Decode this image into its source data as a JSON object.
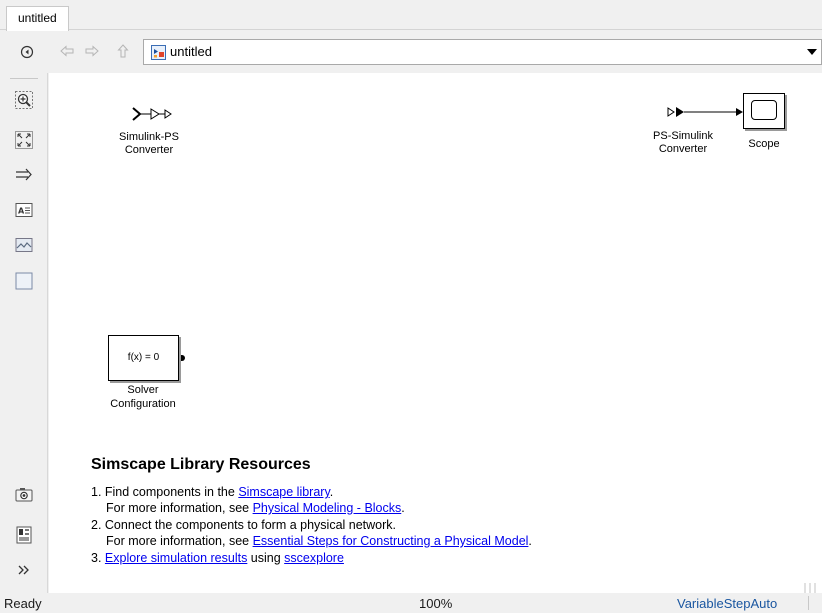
{
  "tab": {
    "label": "untitled"
  },
  "explorer": {
    "path": "untitled"
  },
  "blocks": {
    "simulink_ps": {
      "line1": "Simulink-PS",
      "line2": "Converter"
    },
    "ps_simulink": {
      "line1": "PS-Simulink",
      "line2": "Converter"
    },
    "scope": {
      "label": "Scope"
    },
    "solver": {
      "expr": "f(x) = 0",
      "line1": "Solver",
      "line2": "Configuration"
    }
  },
  "resources": {
    "title": "Simscape Library Resources",
    "line1": {
      "prefix": "1. Find components in the ",
      "link": "Simscape library",
      "suffix": "."
    },
    "line2": {
      "prefix": "For more information, see ",
      "link": "Physical Modeling - Blocks",
      "suffix": "."
    },
    "line3": {
      "text": "2. Connect the components to form a physical network."
    },
    "line4": {
      "prefix": "For more information, see ",
      "link": "Essential Steps for Constructing a Physical Model",
      "suffix": "."
    },
    "line5": {
      "prefix": "3. ",
      "link": "Explore simulation results",
      "middle": " using ",
      "link2": "sscexplore"
    }
  },
  "status": {
    "state": "Ready",
    "zoom": "100%",
    "solver": "VariableStepAuto"
  }
}
